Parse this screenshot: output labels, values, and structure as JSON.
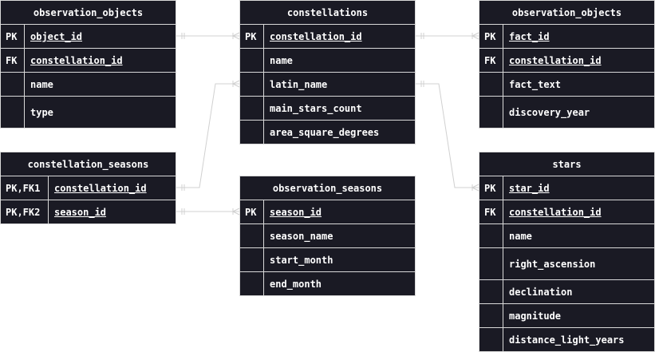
{
  "entities": {
    "obs_objects_1": {
      "title": "observation_objects",
      "rows": [
        {
          "key": "PK",
          "name": "object_id"
        },
        {
          "key": "FK",
          "name": "constellation_id"
        },
        {
          "key": "",
          "name": "name"
        },
        {
          "key": "",
          "name": "type"
        }
      ]
    },
    "constellations": {
      "title": "constellations",
      "rows": [
        {
          "key": "PK",
          "name": "constellation_id"
        },
        {
          "key": "",
          "name": "name"
        },
        {
          "key": "",
          "name": "latin_name"
        },
        {
          "key": "",
          "name": "main_stars_count"
        },
        {
          "key": "",
          "name": "area_square_degrees"
        }
      ]
    },
    "obs_objects_2": {
      "title": "observation_objects",
      "rows": [
        {
          "key": "PK",
          "name": "fact_id"
        },
        {
          "key": "FK",
          "name": "constellation_id"
        },
        {
          "key": "",
          "name": "fact_text"
        },
        {
          "key": "",
          "name": "discovery_year"
        }
      ]
    },
    "constellation_seasons": {
      "title": "constellation_seasons",
      "rows": [
        {
          "key": "PK,FK1",
          "name": "constellation_id"
        },
        {
          "key": "PK,FK2",
          "name": "season_id"
        }
      ]
    },
    "observation_seasons": {
      "title": "observation_seasons",
      "rows": [
        {
          "key": "PK",
          "name": "season_id"
        },
        {
          "key": "",
          "name": "season_name"
        },
        {
          "key": "",
          "name": "start_month"
        },
        {
          "key": "",
          "name": "end_month"
        }
      ]
    },
    "stars": {
      "title": "stars",
      "rows": [
        {
          "key": "PK",
          "name": "star_id"
        },
        {
          "key": "FK",
          "name": "constellation_id"
        },
        {
          "key": "",
          "name": "name"
        },
        {
          "key": "",
          "name": "right_ascension"
        },
        {
          "key": "",
          "name": "declination"
        },
        {
          "key": "",
          "name": "magnitude"
        },
        {
          "key": "",
          "name": "distance_light_years"
        }
      ]
    }
  }
}
